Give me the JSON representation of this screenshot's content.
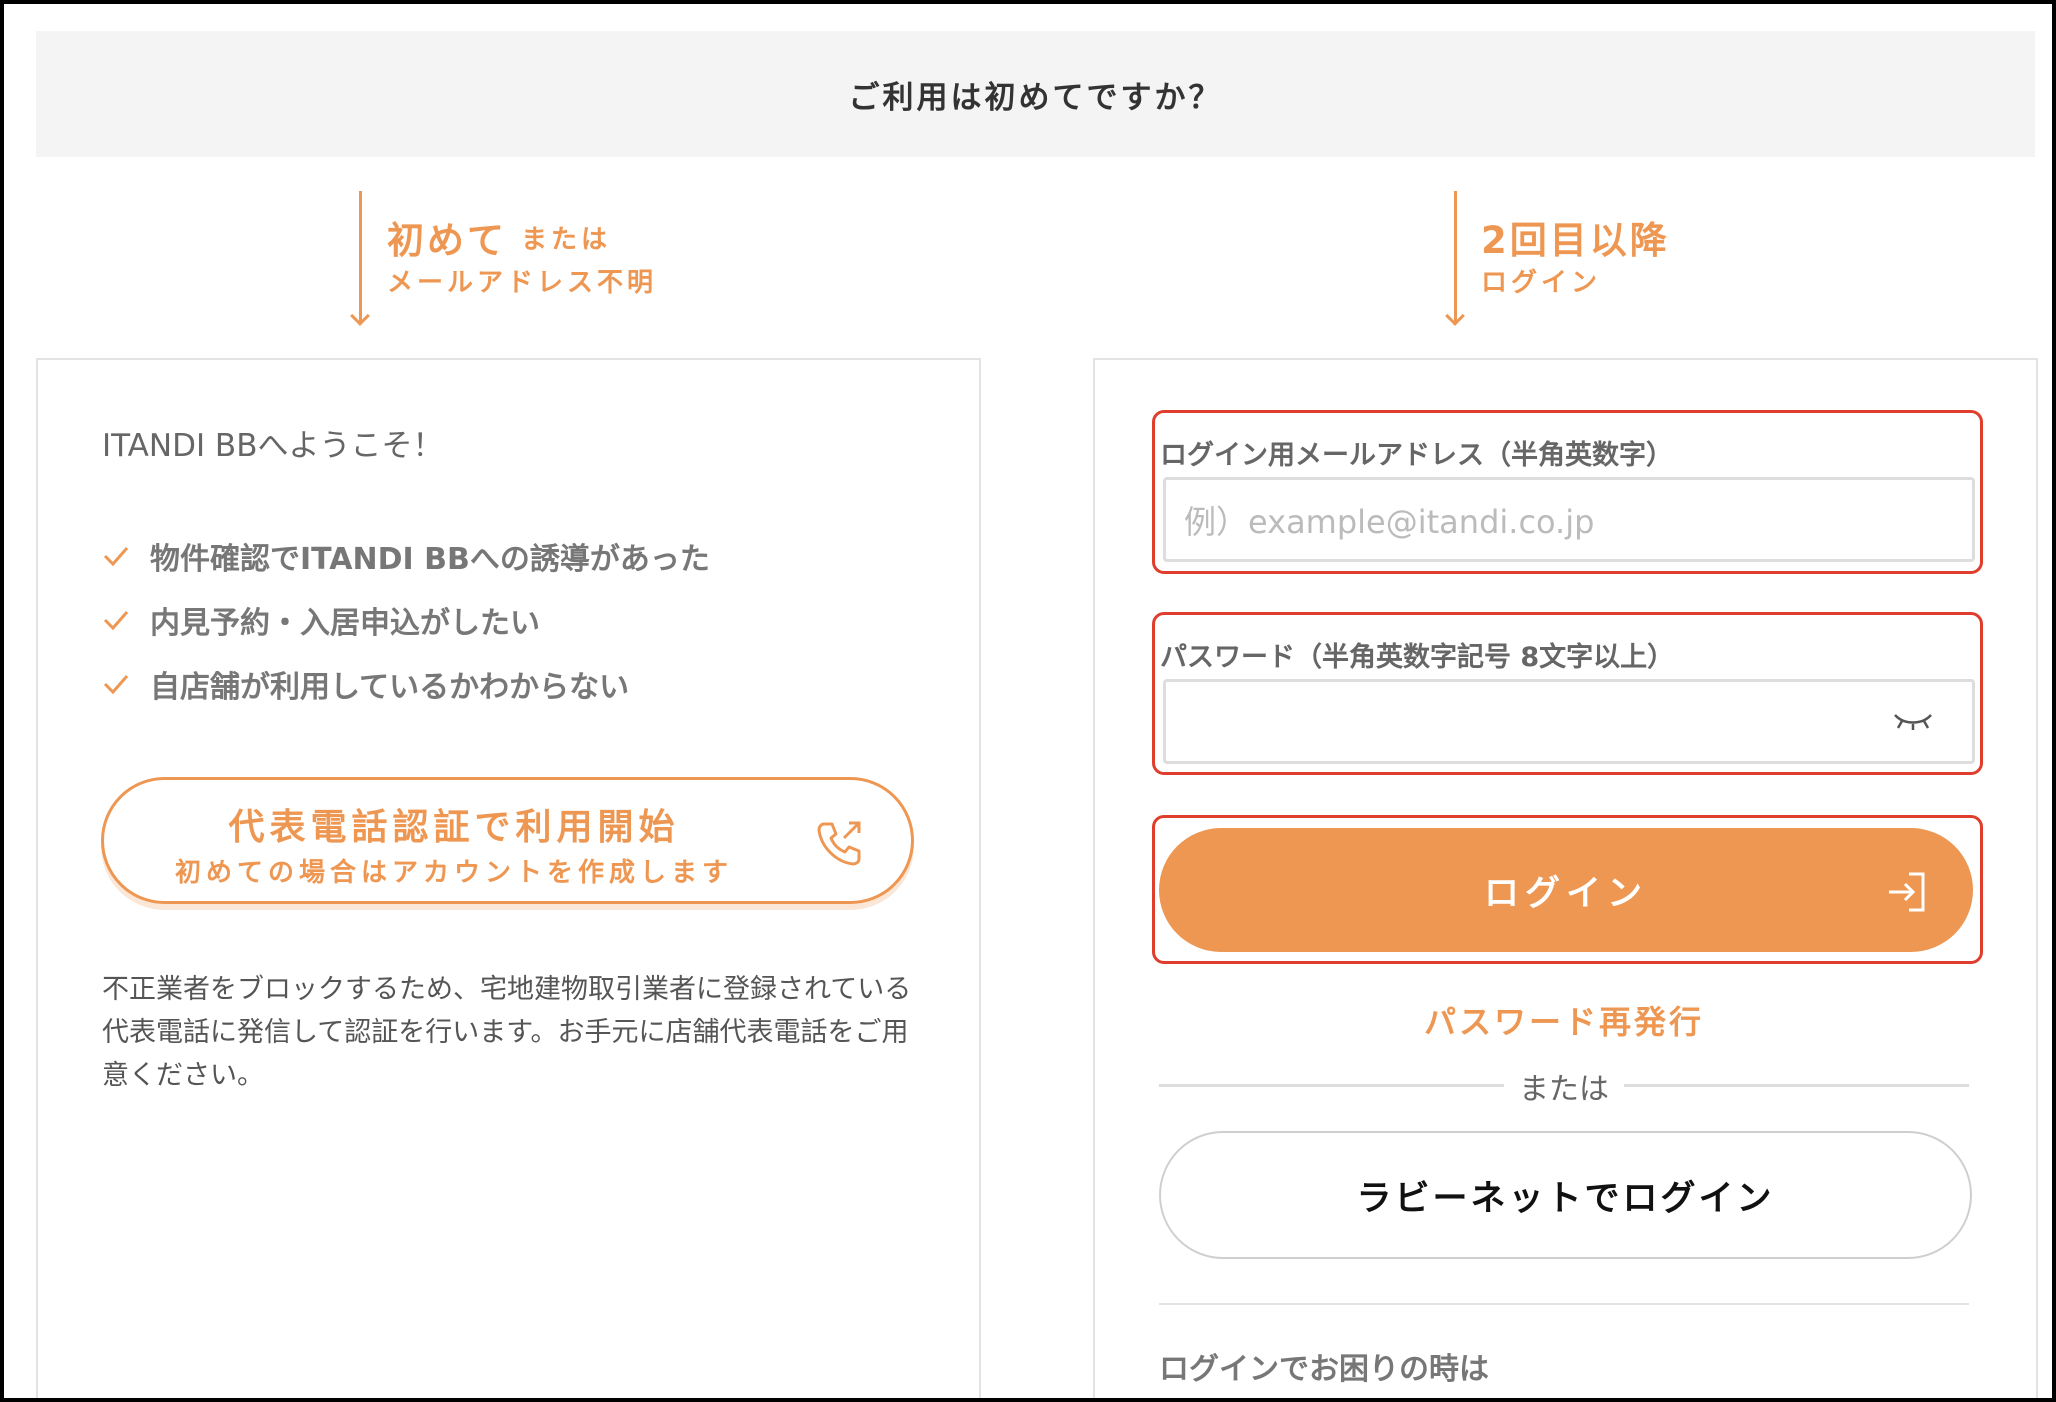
{
  "banner": {
    "question": "ご利用は初めてですか？"
  },
  "left_route": {
    "title": "初めて",
    "or": "または",
    "subtitle": "メールアドレス不明"
  },
  "right_route": {
    "title": "2回目以降",
    "subtitle": "ログイン"
  },
  "left_panel": {
    "welcome": "ITANDI BBへようこそ！",
    "checklist": [
      "物件確認でITANDI BBへの誘導があった",
      "内見予約・入居申込がしたい",
      "自店舗が利用しているかわからない"
    ],
    "phone_button": {
      "title": "代表電話認証で利用開始",
      "subtitle": "初めての場合はアカウントを作成します",
      "icon": "phone-outgoing-icon"
    },
    "notice": "不正業者をブロックするため、宅地建物取引業者に登録されている代表電話に発信して認証を行います。お手元に店舗代表電話をご用意ください。"
  },
  "login_form": {
    "email_label": "ログイン用メールアドレス（半角英数字）",
    "email_placeholder": "例）example@itandi.co.jp",
    "email_value": "",
    "password_label": "パスワード（半角英数字記号 8文字以上）",
    "password_value": "",
    "password_toggle_icon": "eye-closed-icon",
    "login_button": "ログイン",
    "login_icon": "login-arrow-icon",
    "reset_link": "パスワード再発行",
    "or_text": "または",
    "rabbynet_button": "ラビーネットでログイン",
    "trouble_heading": "ログインでお困りの時は"
  },
  "colors": {
    "accent": "#ee9753",
    "highlight_border": "#e03e2d",
    "banner_bg": "#f4f4f4"
  }
}
